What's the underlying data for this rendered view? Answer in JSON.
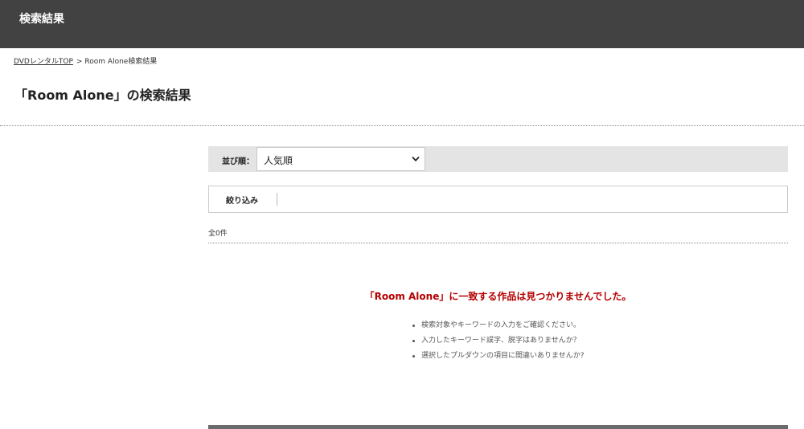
{
  "header": {
    "title": "検索結果"
  },
  "breadcrumb": {
    "home_link": "DVDレンタルTOP",
    "separator": ">",
    "current": "Room Alone検索結果"
  },
  "page_title": "「Room Alone」の検索結果",
  "sort": {
    "label": "並び順：",
    "selected": "人気順"
  },
  "filter": {
    "label": "絞り込み"
  },
  "result_count": "全0件",
  "no_result": {
    "message": "「Room Alone」に一致する作品は見つかりませんでした。",
    "hints": [
      "検索対象やキーワードの入力をご確認ください。",
      "入力したキーワード誤字、脱字はありませんか？",
      "選択したプルダウンの項目に間違いありませんか?"
    ]
  },
  "colors": {
    "header_bg": "#424242",
    "sort_bar_bg": "#e4e4e4",
    "no_result_text": "#b40000"
  },
  "icons": {
    "sort_arrow": "chevron-down-icon"
  }
}
